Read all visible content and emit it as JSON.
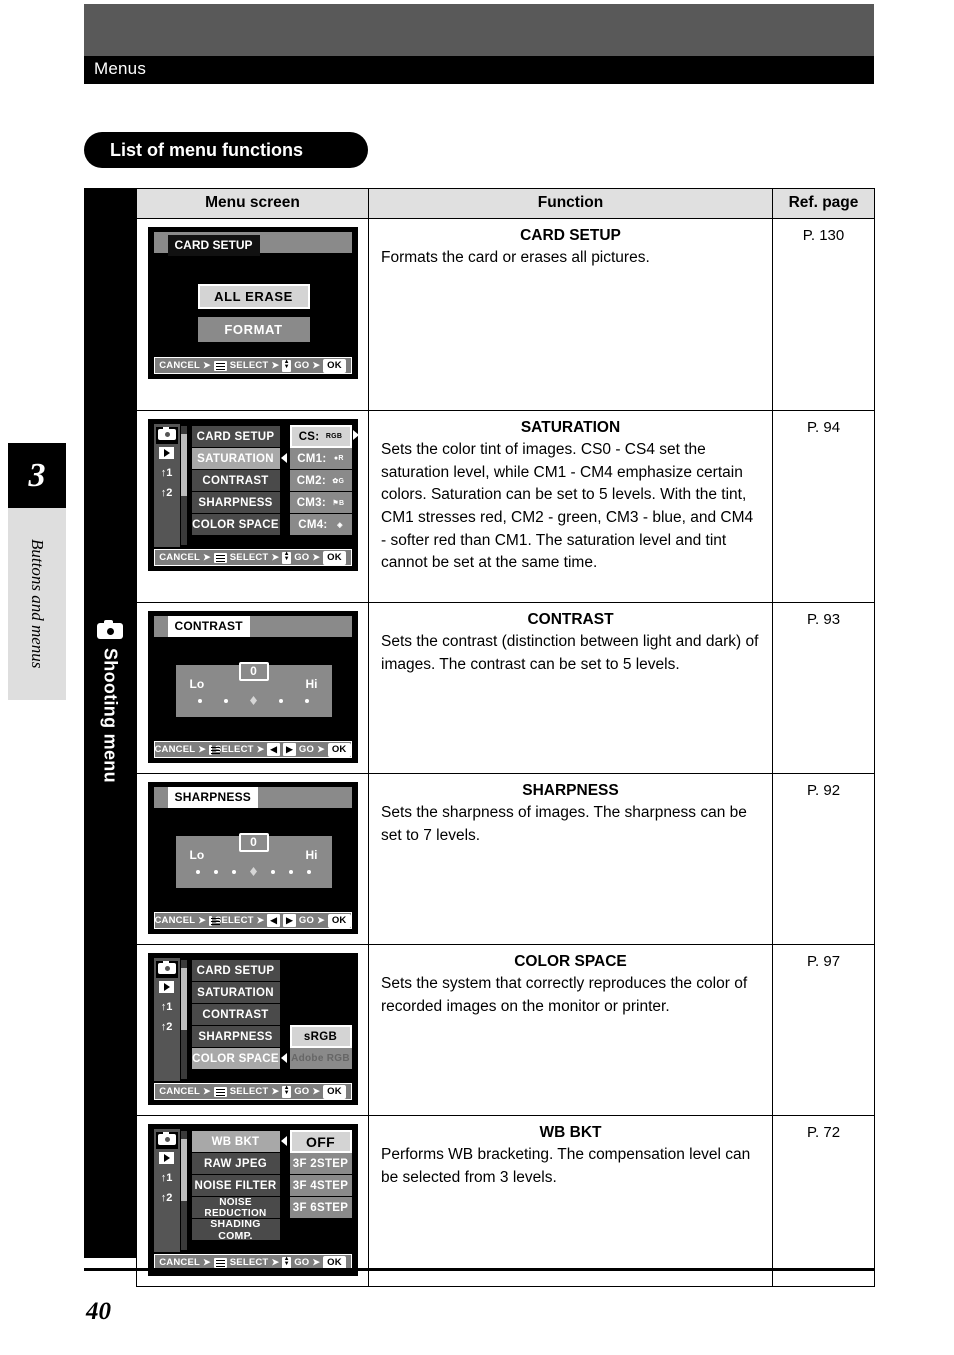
{
  "header": {
    "running_title": "Menus",
    "section_title": "List of menu functions"
  },
  "chapter_tab": {
    "number": "3",
    "label": "Buttons and menus"
  },
  "side_band": {
    "icon": "camera-icon",
    "label": "Shooting menu"
  },
  "table": {
    "columns": [
      "Menu screen",
      "Function",
      "Ref. page"
    ],
    "rows": [
      {
        "function_title": "CARD SETUP",
        "function_body": "Formats the card or erases all pictures.",
        "ref_page": "P. 130",
        "screen": {
          "kind": "dialog",
          "title": "CARD SETUP",
          "buttons": [
            {
              "label": "ALL ERASE",
              "state": "highlight"
            },
            {
              "label": "FORMAT",
              "state": "normal"
            }
          ],
          "guide": {
            "cancel": "CANCEL",
            "select": "SELECT",
            "go": "GO",
            "ok": "OK",
            "pad": "updown"
          }
        }
      },
      {
        "function_title": "SATURATION",
        "function_body": "Sets the color tint of images. CS0 - CS4 set the saturation level, while CM1 - CM4 emphasize certain colors. Saturation can be set to 5 levels. With the tint, CM1 stresses red, CM2 - green, CM3 - blue, and CM4 - softer red than CM1. The saturation level and tint cannot be set at the same time.",
        "ref_page": "P. 94",
        "screen": {
          "kind": "list",
          "left_items": [
            {
              "label": "CARD SETUP",
              "state": "dark"
            },
            {
              "label": "SATURATION",
              "state": "selected"
            },
            {
              "label": "CONTRAST",
              "state": "dark"
            },
            {
              "label": "SHARPNESS",
              "state": "dark"
            },
            {
              "label": "COLOR SPACE",
              "state": "dark"
            }
          ],
          "right_items": [
            {
              "label": "CS:",
              "badge": "RGB",
              "state": "highlight"
            },
            {
              "label": "CM1:",
              "badge": "R",
              "state": "mid"
            },
            {
              "label": "CM2:",
              "badge": "G",
              "state": "mid"
            },
            {
              "label": "CM3:",
              "badge": "B",
              "state": "mid"
            },
            {
              "label": "CM4:",
              "badge": "",
              "state": "mid"
            }
          ],
          "tabs": [
            "camera-tab",
            "playback-tab",
            "wrench1-tab",
            "wrench2-tab"
          ],
          "guide": {
            "cancel": "CANCEL",
            "select": "SELECT",
            "go": "GO",
            "ok": "OK",
            "pad": "fourway"
          }
        }
      },
      {
        "function_title": "CONTRAST",
        "function_body": "Sets the contrast (distinction between light and dark) of images. The contrast can be set to 5 levels.",
        "ref_page": "P. 93",
        "screen": {
          "kind": "slider",
          "title": "CONTRAST",
          "lo_label": "Lo",
          "hi_label": "Hi",
          "value_label": "0",
          "steps": 5,
          "selected_index": 2,
          "guide": {
            "cancel": "CANCEL",
            "select": "SELECT",
            "go": "GO",
            "ok": "OK",
            "pad": "leftright"
          }
        }
      },
      {
        "function_title": "SHARPNESS",
        "function_body": "Sets the sharpness of images. The sharpness can be set to 7 levels.",
        "ref_page": "P. 92",
        "screen": {
          "kind": "slider",
          "title": "SHARPNESS",
          "lo_label": "Lo",
          "hi_label": "Hi",
          "value_label": "0",
          "steps": 7,
          "selected_index": 3,
          "guide": {
            "cancel": "CANCEL",
            "select": "SELECT",
            "go": "GO",
            "ok": "OK",
            "pad": "leftright"
          }
        }
      },
      {
        "function_title": "COLOR SPACE",
        "function_body": "Sets the system that correctly reproduces the color of recorded images on the monitor or printer.",
        "ref_page": "P. 97",
        "screen": {
          "kind": "list",
          "left_items": [
            {
              "label": "CARD SETUP",
              "state": "dark"
            },
            {
              "label": "SATURATION",
              "state": "dark"
            },
            {
              "label": "CONTRAST",
              "state": "dark"
            },
            {
              "label": "SHARPNESS",
              "state": "dark"
            },
            {
              "label": "COLOR SPACE",
              "state": "selected"
            }
          ],
          "right_items": [
            {
              "label": "",
              "state": "none"
            },
            {
              "label": "",
              "state": "none"
            },
            {
              "label": "",
              "state": "none"
            },
            {
              "label": "sRGB",
              "state": "highlight"
            },
            {
              "label": "Adobe RGB",
              "state": "dim"
            }
          ],
          "tabs": [
            "camera-tab",
            "playback-tab",
            "wrench1-tab",
            "wrench2-tab"
          ],
          "guide": {
            "cancel": "CANCEL",
            "select": "SELECT",
            "go": "GO",
            "ok": "OK",
            "pad": "fourway"
          }
        }
      },
      {
        "function_title": "WB BKT",
        "function_body": "Performs WB bracketing. The compensation level can be selected from 3 levels.",
        "ref_page": "P. 72",
        "screen": {
          "kind": "list",
          "left_items": [
            {
              "label": "WB BKT",
              "state": "selected"
            },
            {
              "label": "RAW JPEG",
              "state": "dark"
            },
            {
              "label": "NOISE FILTER",
              "state": "dark"
            },
            {
              "label": "NOISE REDUCTION",
              "state": "dark"
            },
            {
              "label": "SHADING COMP.",
              "state": "dark"
            }
          ],
          "right_items": [
            {
              "label": "OFF",
              "state": "highlight"
            },
            {
              "label": "3F 2STEP",
              "state": "mid"
            },
            {
              "label": "3F 4STEP",
              "state": "mid"
            },
            {
              "label": "3F 6STEP",
              "state": "mid"
            },
            {
              "label": "",
              "state": "none"
            }
          ],
          "tabs": [
            "camera-tab",
            "playback-tab",
            "wrench1-tab",
            "wrench2-tab"
          ],
          "guide": {
            "cancel": "CANCEL",
            "select": "SELECT",
            "go": "GO",
            "ok": "OK",
            "pad": "fourway"
          }
        }
      }
    ]
  },
  "footer": {
    "page_number": "40"
  }
}
